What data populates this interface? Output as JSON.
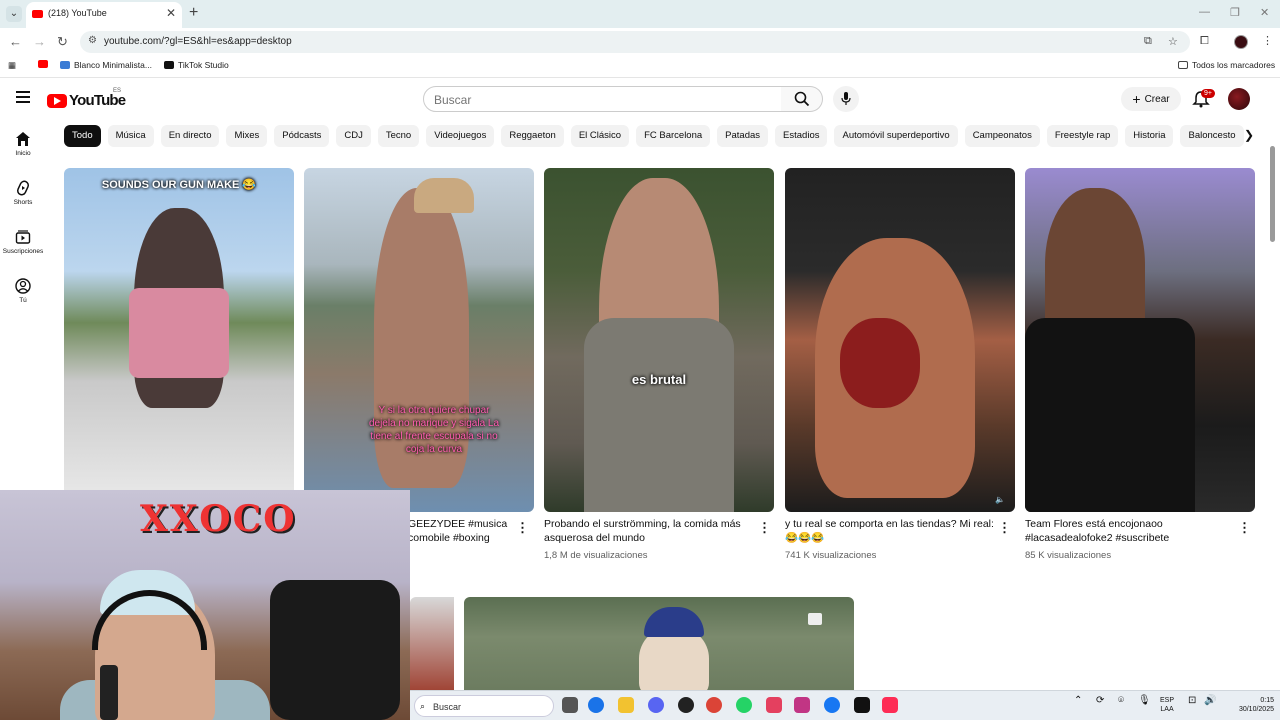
{
  "browser": {
    "tab_title": "(218) YouTube",
    "url": "youtube.com/?gl=ES&hl=es&app=desktop",
    "bookmarks": [
      "Blanco Minimalista...",
      "TikTok Studio"
    ],
    "all_bookmarks": "Todos los marcadores"
  },
  "youtube": {
    "logo_text": "YouTube",
    "country_code": "ES",
    "search_placeholder": "Buscar",
    "create_label": "Crear",
    "notifications_badge": "9+",
    "sidebar": [
      {
        "label": "Inicio",
        "icon": "home-icon"
      },
      {
        "label": "Shorts",
        "icon": "shorts-icon"
      },
      {
        "label": "Suscripciones",
        "icon": "subscriptions-icon"
      },
      {
        "label": "Tú",
        "icon": "you-icon"
      }
    ],
    "chips": [
      "Todo",
      "Música",
      "En directo",
      "Mixes",
      "Pódcasts",
      "CDJ",
      "Tecno",
      "Videojuegos",
      "Reggaeton",
      "El Clásico",
      "FC Barcelona",
      "Patadas",
      "Estadios",
      "Automóvil superdeportivo",
      "Campeonatos",
      "Freestyle rap",
      "Historia",
      "Baloncesto"
    ],
    "videos": [
      {
        "caption": "SOUNDS OUR GUN MAKE 😂",
        "title": "",
        "meta": ""
      },
      {
        "caption": "Y si la otra quiere chupar dejela no marique y sigala La tiene al frente escupala si no coja la curva",
        "title": "GEEZYDEE #musica comobile #boxing",
        "meta": ""
      },
      {
        "caption": "es brutal",
        "title": "Probando el surströmming, la comida más asquerosa del mundo",
        "meta": "1,8 M de visualizaciones"
      },
      {
        "caption": "",
        "title": "y tu real se comporta en las tiendas? Mi real: 😂😂😂",
        "meta": "741 K visualizaciones"
      },
      {
        "caption": "",
        "title": "Team Flores está encojonaoo #lacasadealofoke2 #suscribete",
        "meta": "85 K visualizaciones"
      }
    ]
  },
  "webcam": {
    "graffiti": "XXOCO"
  },
  "taskbar": {
    "search_label": "Buscar",
    "lang_top": "ESP",
    "lang_bottom": "LAA",
    "time": "0:15",
    "date": "30/10/2025"
  }
}
